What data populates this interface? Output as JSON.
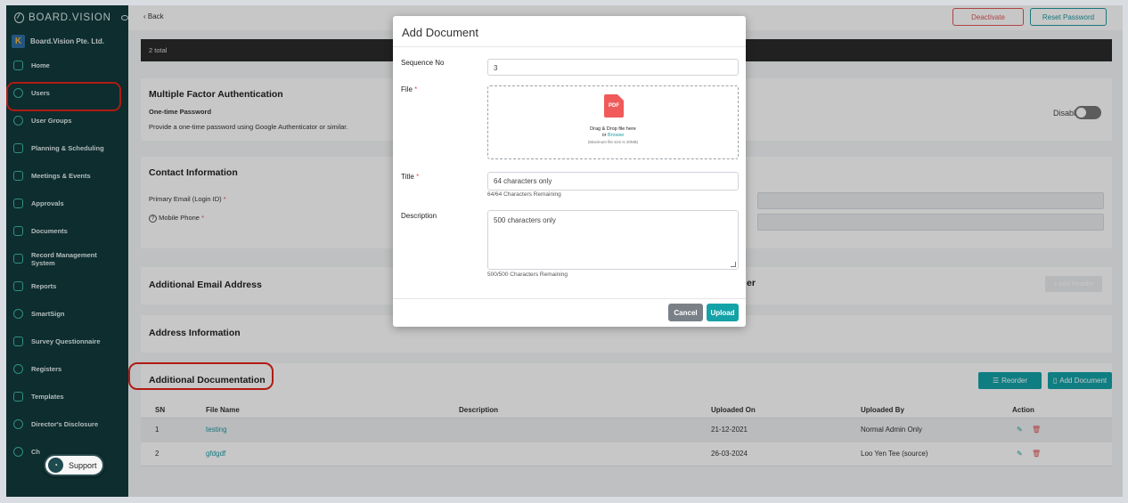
{
  "brand": {
    "name": "BOARD.VISION"
  },
  "organization": {
    "name": "Board.Vision Pte. Ltd.",
    "logo_letter": "K"
  },
  "sidebar": {
    "items": [
      {
        "label": "Home",
        "icon": "home-icon"
      },
      {
        "label": "Users",
        "icon": "user-icon"
      },
      {
        "label": "User Groups",
        "icon": "user-groups-icon"
      },
      {
        "label": "Planning & Scheduling",
        "icon": "chart-icon"
      },
      {
        "label": "Meetings & Events",
        "icon": "calendar-icon"
      },
      {
        "label": "Approvals",
        "icon": "approvals-icon"
      },
      {
        "label": "Documents",
        "icon": "documents-icon"
      },
      {
        "label": "Record Management System",
        "icon": "records-icon"
      },
      {
        "label": "Reports",
        "icon": "reports-icon"
      },
      {
        "label": "SmartSign",
        "icon": "signature-icon"
      },
      {
        "label": "Survey Questionnaire",
        "icon": "survey-icon"
      },
      {
        "label": "Registers",
        "icon": "registers-icon"
      },
      {
        "label": "Templates",
        "icon": "templates-icon"
      },
      {
        "label": "Director's Disclosure",
        "icon": "disclosure-icon"
      },
      {
        "label": "Ch",
        "icon": "chat-icon"
      }
    ]
  },
  "support": {
    "label": "Support"
  },
  "topbar": {
    "back_label": "Back",
    "deactivate_label": "Deactivate",
    "reset_password_label": "Reset Password"
  },
  "summary": {
    "total_label": "2 total"
  },
  "mfa": {
    "title": "Multiple Factor Authentication",
    "subtitle": "One-time Password",
    "description": "Provide a one-time password using Google Authenticator or similar.",
    "status": "Disabled"
  },
  "contact": {
    "title": "Contact Information",
    "primary_email_label": "Primary Email (Login ID)",
    "mobile_phone_label": "Mobile Phone",
    "required_mark": "*"
  },
  "additional_email": {
    "title": "Additional Email Address",
    "partial_title": "er",
    "add_reorder_label": "+ Add Reorder"
  },
  "address": {
    "title": "Address Information"
  },
  "documentation": {
    "title": "Additional Documentation",
    "reorder_label": "Reorder",
    "add_document_label": "Add Document",
    "columns": [
      "SN",
      "File Name",
      "Description",
      "Uploaded On",
      "Uploaded By",
      "Action"
    ],
    "rows": [
      {
        "sn": "1",
        "file_name": "testing",
        "description": "",
        "uploaded_on": "21-12-2021",
        "uploaded_by": "Normal Admin Only"
      },
      {
        "sn": "2",
        "file_name": "gfdgdf",
        "description": "",
        "uploaded_on": "26-03-2024",
        "uploaded_by": "Loo Yen Tee (source)"
      }
    ]
  },
  "modal": {
    "title": "Add Document",
    "sequence_label": "Sequence No",
    "sequence_value": "3",
    "file_label": "File",
    "dropzone_badge": "PDF",
    "dropzone_line1": "Drag & Drop file here",
    "dropzone_or": "or",
    "dropzone_browse": "Browse",
    "dropzone_limit": "(Maximum file size is 20MB)",
    "title_label": "Title",
    "title_placeholder": "64 characters only",
    "title_hint": "64/64 Characters Remaining",
    "description_label": "Description",
    "description_placeholder": "500 characters only",
    "description_hint": "500/500 Characters Remaining",
    "cancel_label": "Cancel",
    "upload_label": "Upload",
    "required_mark": "*"
  },
  "colors": {
    "sidebar": "#113a3d",
    "accent": "#14a2a8",
    "danger": "#e05656",
    "highlight": "#e2231a"
  }
}
